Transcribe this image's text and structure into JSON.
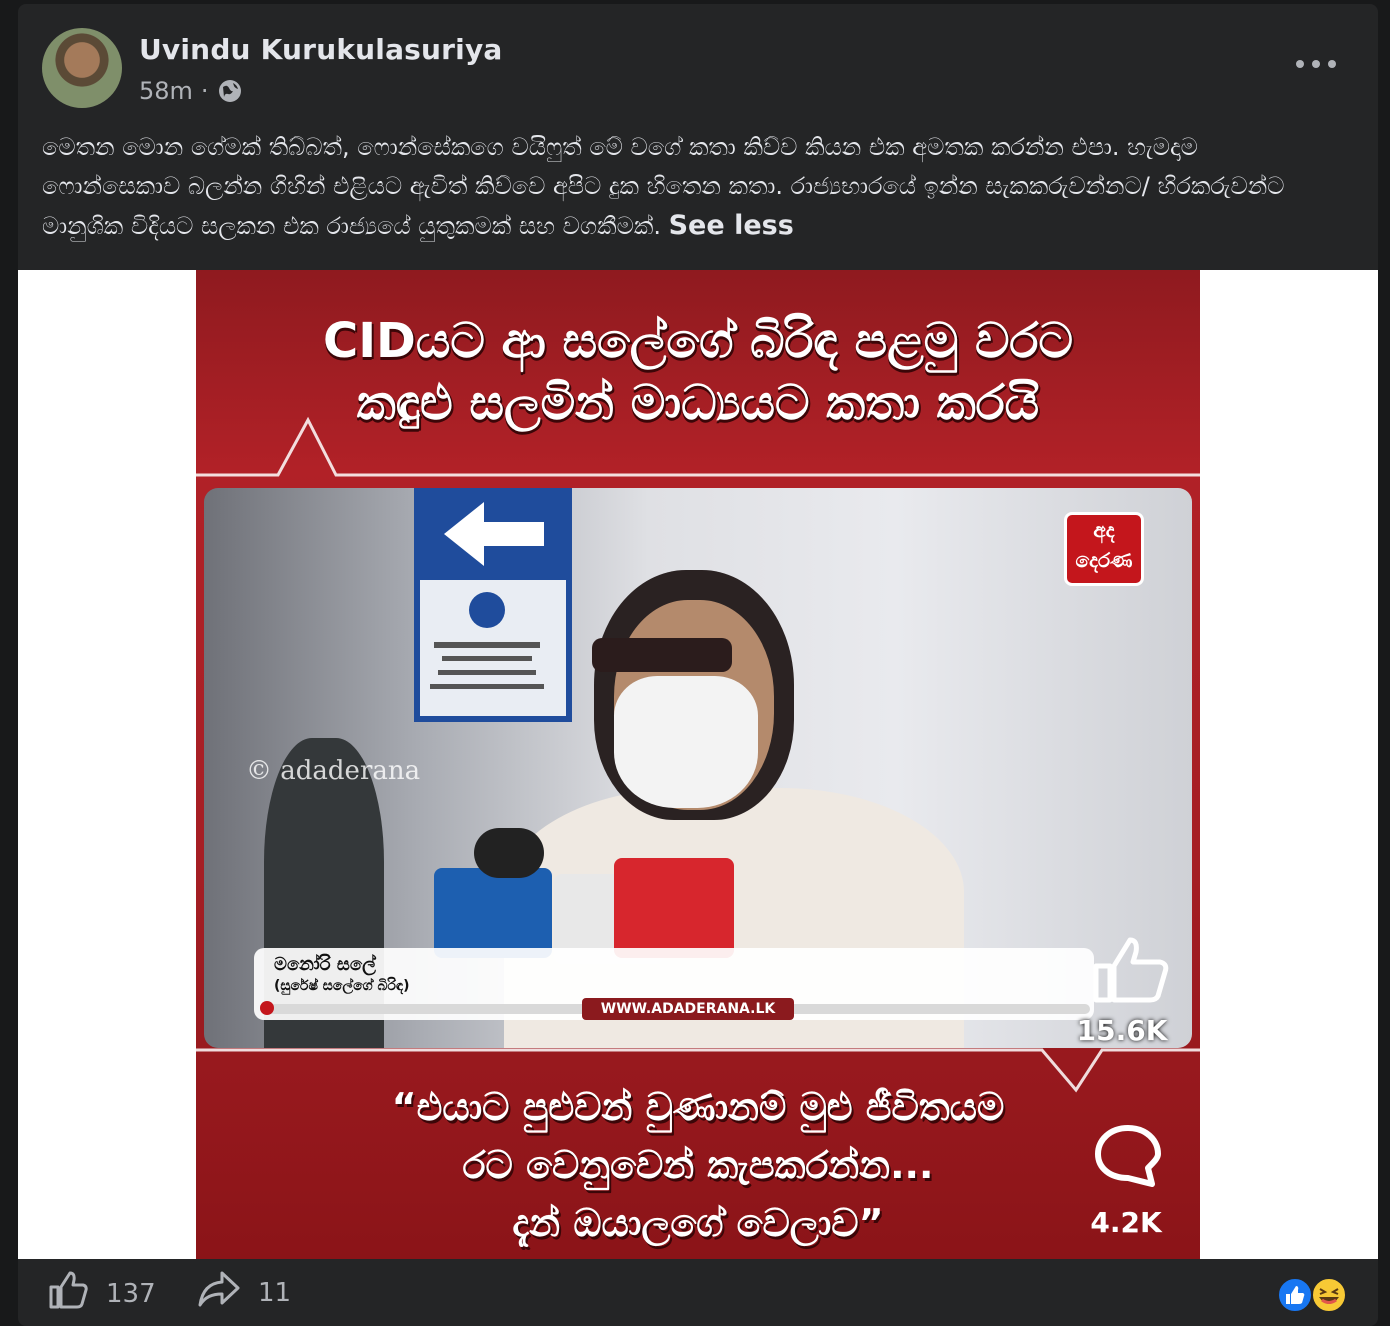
{
  "post": {
    "author": "Uvindu Kurukulasuriya",
    "time": "58m",
    "separator": "·",
    "audience_icon": "globe-icon",
    "body": "මෙතන මොන ගේමක් තිබ්බත්, ෆොන්සේකගෙ වයිෆුත් මේ වගේ කතා කිව්ව කියන එක අමතක කරන්න එපා. හැමදාම ෆොන්සෙකාව බලන්න ගිහින් එළියට ඇවිත් කිව්වෙ අපිට දුක හිතෙන කතා. රාජ්‍යභාරයේ ඉන්න සැකකරුවන්නට/ හිරකරුවන්ට මානුශික විදියට සලකන එක රාජ්‍යයේ යුතුකමක් සහ වගකීමක්.",
    "see_less": "See less"
  },
  "media": {
    "headline_line1": "CIDයට ආ සලේගේ බිරිඳ පළමු වරට",
    "headline_line2": "කඳුළු සලමින් මාධ්‍යයට කතා කරයි",
    "watermark": "© adaderana",
    "channel_logo": "අද දෙරණ",
    "speaker_name": "මනෝරි සලේ",
    "speaker_role": "(සුරේෂ් සලේගේ බිරිඳ)",
    "site_url": "WWW.ADADERANA.LK",
    "overlay_like_count": "15.6K",
    "overlay_comment_count": "4.2K",
    "quote_line1": "“එයාට පුළුවන් වුණානම් මුළු ජීවිතයම",
    "quote_line2": "රට වෙනුවෙන් කැපකරන්න...",
    "quote_line3": "දැන් ඔයාලගේ වෙලාව”"
  },
  "footer": {
    "like_count": "137",
    "share_count": "11",
    "reaction_icons": [
      "like-reaction-icon",
      "haha-reaction-icon"
    ]
  },
  "colors": {
    "background": "#18191a",
    "card": "#242526",
    "text_primary": "#e4e6eb",
    "text_secondary": "#b0b3b8",
    "brand_red": "#b12127",
    "like_blue": "#1877f2"
  }
}
